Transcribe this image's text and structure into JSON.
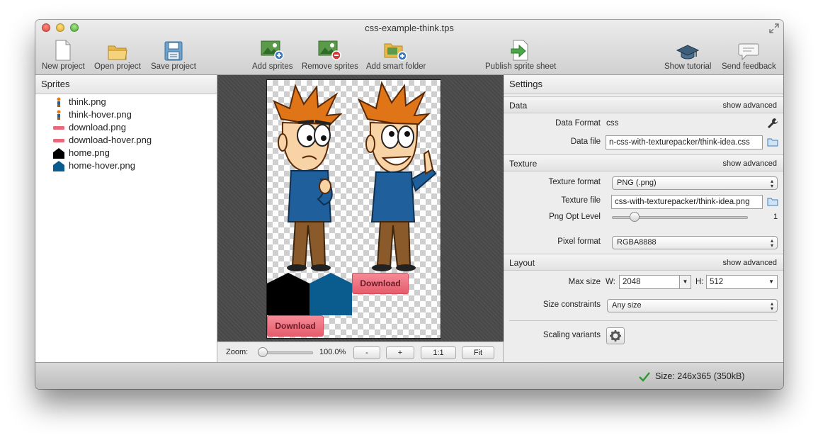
{
  "window": {
    "title": "css-example-think.tps"
  },
  "toolbar": {
    "new_project": "New project",
    "open_project": "Open project",
    "save_project": "Save project",
    "add_sprites": "Add sprites",
    "remove_sprites": "Remove sprites",
    "add_smart_folder": "Add smart folder",
    "publish": "Publish sprite sheet",
    "show_tutorial": "Show tutorial",
    "send_feedback": "Send feedback"
  },
  "sprites": {
    "title": "Sprites",
    "items": [
      {
        "name": "think.png"
      },
      {
        "name": "think-hover.png"
      },
      {
        "name": "download.png"
      },
      {
        "name": "download-hover.png"
      },
      {
        "name": "home.png"
      },
      {
        "name": "home-hover.png"
      }
    ]
  },
  "canvas": {
    "download_label": "Download",
    "download_hover_label": "Download"
  },
  "zoom": {
    "label": "Zoom:",
    "value": "100.0%",
    "slider_fraction": 0.0,
    "btn_minus": "-",
    "btn_plus": "+",
    "btn_1to1": "1:1",
    "btn_fit": "Fit"
  },
  "settings": {
    "title": "Settings",
    "data": {
      "header": "Data",
      "advanced": "show advanced",
      "format_label": "Data Format",
      "format_value": "css",
      "file_label": "Data file",
      "file_value": "n-css-with-texturepacker/think-idea.css"
    },
    "texture": {
      "header": "Texture",
      "advanced": "show advanced",
      "format_label": "Texture format",
      "format_value": "PNG (.png)",
      "file_label": "Texture file",
      "file_value": "css-with-texturepacker/think-idea.png",
      "opt_label": "Png Opt Level",
      "opt_value": "1",
      "pixel_label": "Pixel format",
      "pixel_value": "RGBA8888"
    },
    "layout": {
      "header": "Layout",
      "advanced": "show advanced",
      "max_size_label": "Max size",
      "w_label": "W:",
      "w_value": "2048",
      "h_label": "H:",
      "h_value": "512",
      "constraints_label": "Size constraints",
      "constraints_value": "Any size",
      "scaling_label": "Scaling variants"
    }
  },
  "status": {
    "size_text": "Size: 246x365 (350kB)"
  },
  "colors": {
    "download": "#f06b7b",
    "home_hover": "#0a5c8f",
    "home": "#000000"
  }
}
